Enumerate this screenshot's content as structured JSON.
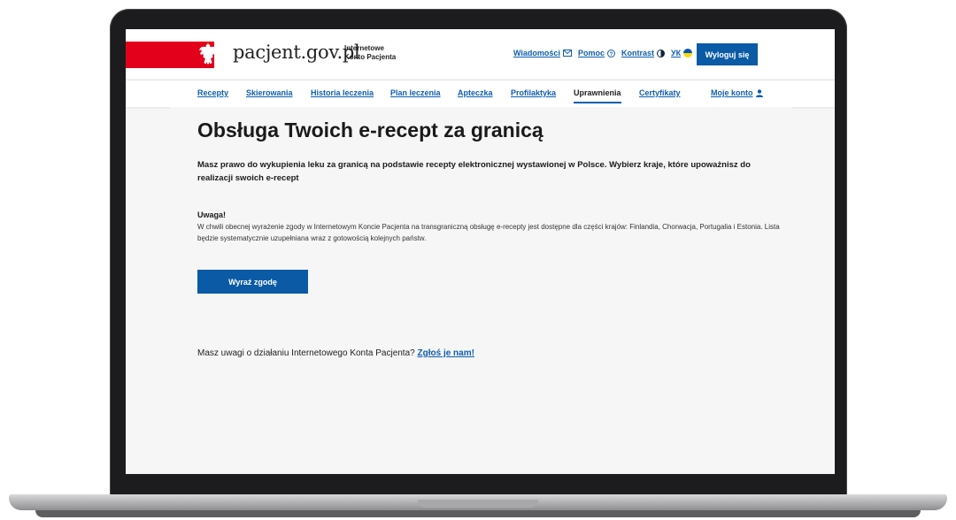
{
  "header": {
    "logo": "pacjent.gov.pl",
    "subtitle_line1": "Internetowe",
    "subtitle_line2": "Konto Pacjenta",
    "links": {
      "news": "Wiadomości",
      "help": "Pomoc",
      "contrast": "Kontrast",
      "ukraine": "УК"
    },
    "logout": "Wyloguj się"
  },
  "nav": {
    "items": [
      "Recepty",
      "Skierowania",
      "Historia leczenia",
      "Plan leczenia",
      "Apteczka",
      "Profilaktyka",
      "Uprawnienia",
      "Certyfikaty"
    ],
    "active": "Uprawnienia",
    "account": "Moje konto"
  },
  "main": {
    "title": "Obsługa Twoich e-recept za granicą",
    "lead": "Masz prawo do wykupienia leku za granicą na podstawie recepty elektronicznej wystawionej w Polsce. Wybierz kraje, które upoważnisz do realizacji swoich e-recept",
    "notice_title": "Uwaga!",
    "notice_text": "W chwili obecnej wyrażenie zgody w Internetowym Koncie Pacjenta na transgraniczną obsługę e-recepty jest dostępne dla części krajów: Finlandia, Chorwacja, Portugalia i Estonia. Lista będzie systematycznie uzupełniana wraz z gotowością kolejnych państw.",
    "consent_button": "Wyraź zgodę",
    "feedback_text": "Masz uwagi o działaniu Internetowego Konta Pacjenta?",
    "feedback_link": "Zgłoś je nam!"
  },
  "colors": {
    "brand_blue": "#0a5aa6",
    "link_blue": "#0d5eb0",
    "flag_red": "#e3001b"
  },
  "icons": [
    "eagle-emblem-icon",
    "envelope-icon",
    "help-circle-icon",
    "contrast-icon",
    "ukraine-flag-icon",
    "user-icon"
  ]
}
